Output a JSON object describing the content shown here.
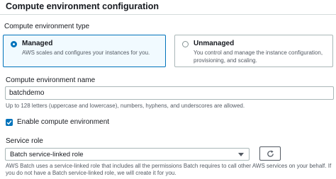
{
  "page": {
    "title": "Compute environment configuration"
  },
  "type_section": {
    "label": "Compute environment type",
    "options": [
      {
        "title": "Managed",
        "description": "AWS scales and configures your instances for you.",
        "selected": true
      },
      {
        "title": "Unmanaged",
        "description": "You control and manage the instance configuration, provisioning, and scaling.",
        "selected": false
      }
    ]
  },
  "name_field": {
    "label": "Compute environment name",
    "value": "batchdemo",
    "hint": "Up to 128 letters (uppercase and lowercase), numbers, hyphens, and underscores are allowed."
  },
  "enable_checkbox": {
    "label": "Enable compute environment",
    "checked": true
  },
  "service_role": {
    "label": "Service role",
    "selected": "Batch service-linked role",
    "description": "AWS Batch uses a service-linked role that includes all the permissions Batch requires to call other AWS services on your behalf. If you do not have a Batch service-linked role, we will create it for you."
  },
  "colors": {
    "accent": "#0073bb",
    "selected_tile_bg": "#f1faff",
    "border": "#aab7b8",
    "secondary_text": "#545b64"
  },
  "icons": {
    "refresh": "refresh-icon",
    "dropdown": "caret-down-icon",
    "check": "check-icon"
  }
}
